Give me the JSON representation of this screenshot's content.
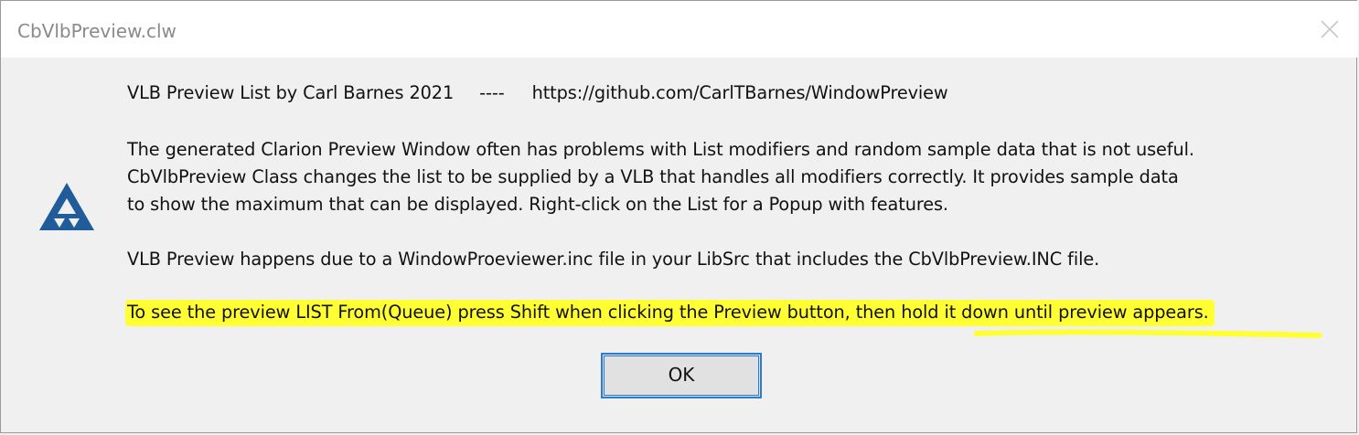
{
  "window": {
    "title": "CbVlbPreview.clw"
  },
  "icons": {
    "close": "close-icon",
    "app": "clarion-triangle-icon"
  },
  "colors": {
    "highlight": "#ffff33",
    "icon_blue": "#1f5c99",
    "button_border": "#2a7bd3"
  },
  "message": {
    "header_left": "VLB Preview List by Carl Barnes 2021",
    "header_sep": "----",
    "header_url": "https://github.com/CarlTBarnes/WindowPreview",
    "paragraph1": [
      "The generated Clarion Preview Window often has problems with List modifiers and random sample data that is not useful.",
      "CbVlbPreview Class changes the list to be supplied by a VLB that handles all modifiers correctly. It provides sample data",
      "to show the maximum that can be displayed. Right-click on the List for a Popup with features."
    ],
    "paragraph2": "VLB Preview happens due to a WindowProeviewer.inc file in your LibSrc that includes the CbVlbPreview.INC file.",
    "paragraph3": "To see the preview LIST From(Queue) press Shift when clicking the Preview button, then hold it down until preview appears."
  },
  "buttons": {
    "ok_label": "OK"
  }
}
